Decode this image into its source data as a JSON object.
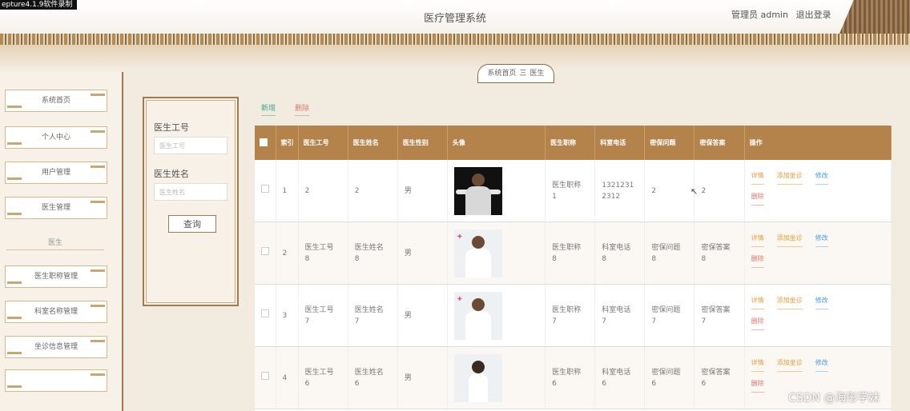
{
  "recorder_label": "epture4.1.9软件录制",
  "header": {
    "title": "医疗管理系统",
    "admin": "管理员 admin",
    "logout": "退出登录"
  },
  "breadcrumb": {
    "home": "系统首页",
    "sep": "三",
    "current": "医生"
  },
  "sidebar": {
    "items": [
      {
        "label": "系统首页"
      },
      {
        "label": "个人中心"
      },
      {
        "label": "用户管理"
      },
      {
        "label": "医生管理"
      }
    ],
    "group_label": "医生",
    "sub_items": [
      {
        "label": "医生职称管理"
      },
      {
        "label": "科室名称管理"
      },
      {
        "label": "坐诊信息管理"
      },
      {
        "label": ""
      }
    ]
  },
  "search": {
    "label1": "医生工号",
    "placeholder1": "医生工号",
    "label2": "医生姓名",
    "placeholder2": "医生姓名",
    "button": "查询"
  },
  "actions": {
    "add": "新增",
    "delete": "删除"
  },
  "table": {
    "headers": [
      "",
      "索引",
      "医生工号",
      "医生姓名",
      "医生性别",
      "头像",
      "医生职称",
      "科室电话",
      "密保问题",
      "密保答案",
      "操作"
    ],
    "rows": [
      {
        "idx": "1",
        "no": "2",
        "name": "2",
        "sex": "男",
        "photo": "doctor-photo-dark",
        "title": "医生职称\n1",
        "phone": "1321231\n2312",
        "q": "2",
        "a": "2"
      },
      {
        "idx": "2",
        "no": "医生工号\n8",
        "name": "医生姓名\n8",
        "sex": "男",
        "photo": "doctor-photo-white-coat",
        "title": "医生职称\n8",
        "phone": "科室电话\n8",
        "q": "密保问题\n8",
        "a": "密保答案\n8"
      },
      {
        "idx": "3",
        "no": "医生工号\n7",
        "name": "医生姓名\n7",
        "sex": "男",
        "photo": "doctor-photo-white-coat",
        "title": "医生职称\n7",
        "phone": "科室电话\n7",
        "q": "密保问题\n7",
        "a": "密保答案\n7"
      },
      {
        "idx": "4",
        "no": "医生工号\n6",
        "name": "医生姓名\n6",
        "sex": "男",
        "photo": "doctor-photo-female",
        "title": "医生职称\n6",
        "phone": "科室电话\n6",
        "q": "密保问题\n6",
        "a": "密保答案\n6"
      }
    ],
    "ops": {
      "detail": "详情",
      "add_visit": "添加坐诊",
      "edit": "修改",
      "delete": "删除"
    }
  },
  "watermark": "CSDN @海彤学妹",
  "colors": {
    "header_brown": "#b4834b",
    "add_green": "#3aa58c",
    "delete_red": "#d9786b",
    "edit_blue": "#4a9ae0",
    "orange": "#e59b3c"
  }
}
